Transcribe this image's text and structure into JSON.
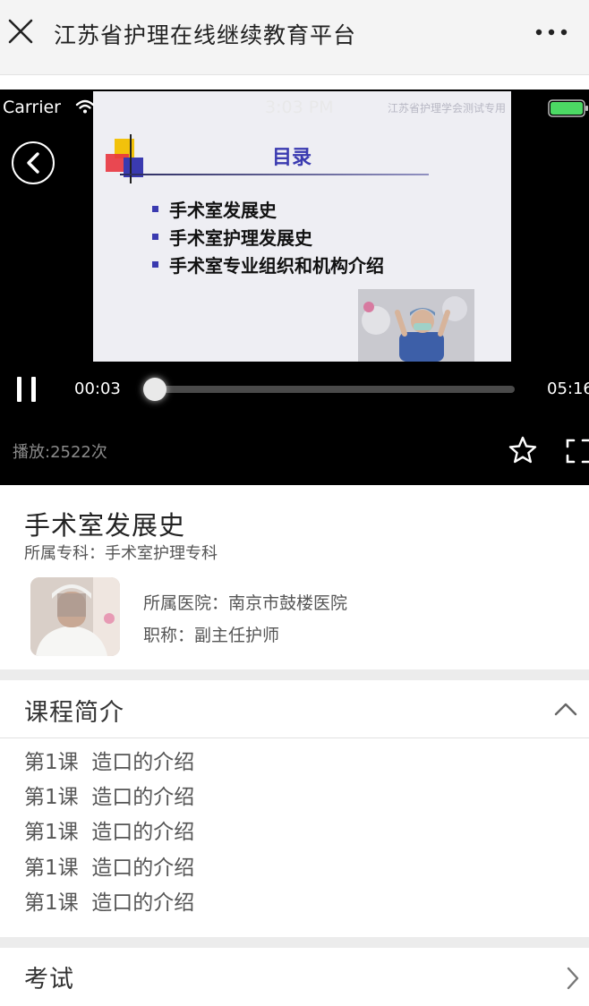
{
  "navbar": {
    "title": "江苏省护理在线继续教育平台"
  },
  "player": {
    "status_bar": {
      "carrier": "Carrier",
      "time": "3:03 PM"
    },
    "slide": {
      "watermark": "江苏省护理学会测试专用",
      "heading": "目录",
      "bullets": [
        "手术室发展史",
        "手术室护理发展史",
        "手术室专业组织和机构介绍"
      ]
    },
    "current_time": "00:03",
    "total_time": "05:16",
    "progress": 0.01,
    "play_count": "播放:2522次"
  },
  "course": {
    "title": "手术室发展史",
    "specialty": "所属专科：手术室护理专科",
    "hospital": "所属医院：南京市鼓楼医院",
    "job_title": "职称：副主任护师"
  },
  "intro": {
    "title": "课程简介",
    "lessons": [
      "第1课  造口的介绍",
      "第1课  造口的介绍",
      "第1课  造口的介绍",
      "第1课  造口的介绍",
      "第1课  造口的介绍"
    ]
  },
  "exam": {
    "title": "考试"
  },
  "colors": {
    "slide_accent": "#3a3ab0",
    "battery": "#4cd964"
  }
}
